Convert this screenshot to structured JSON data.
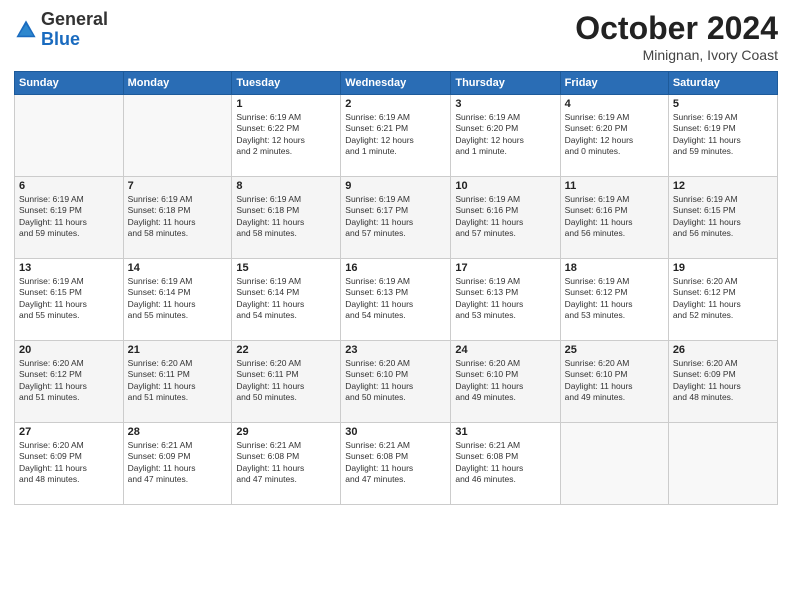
{
  "logo": {
    "general": "General",
    "blue": "Blue"
  },
  "header": {
    "month": "October 2024",
    "location": "Minignan, Ivory Coast"
  },
  "days_of_week": [
    "Sunday",
    "Monday",
    "Tuesday",
    "Wednesday",
    "Thursday",
    "Friday",
    "Saturday"
  ],
  "weeks": [
    [
      {
        "day": "",
        "info": ""
      },
      {
        "day": "",
        "info": ""
      },
      {
        "day": "1",
        "info": "Sunrise: 6:19 AM\nSunset: 6:22 PM\nDaylight: 12 hours\nand 2 minutes."
      },
      {
        "day": "2",
        "info": "Sunrise: 6:19 AM\nSunset: 6:21 PM\nDaylight: 12 hours\nand 1 minute."
      },
      {
        "day": "3",
        "info": "Sunrise: 6:19 AM\nSunset: 6:20 PM\nDaylight: 12 hours\nand 1 minute."
      },
      {
        "day": "4",
        "info": "Sunrise: 6:19 AM\nSunset: 6:20 PM\nDaylight: 12 hours\nand 0 minutes."
      },
      {
        "day": "5",
        "info": "Sunrise: 6:19 AM\nSunset: 6:19 PM\nDaylight: 11 hours\nand 59 minutes."
      }
    ],
    [
      {
        "day": "6",
        "info": "Sunrise: 6:19 AM\nSunset: 6:19 PM\nDaylight: 11 hours\nand 59 minutes."
      },
      {
        "day": "7",
        "info": "Sunrise: 6:19 AM\nSunset: 6:18 PM\nDaylight: 11 hours\nand 58 minutes."
      },
      {
        "day": "8",
        "info": "Sunrise: 6:19 AM\nSunset: 6:18 PM\nDaylight: 11 hours\nand 58 minutes."
      },
      {
        "day": "9",
        "info": "Sunrise: 6:19 AM\nSunset: 6:17 PM\nDaylight: 11 hours\nand 57 minutes."
      },
      {
        "day": "10",
        "info": "Sunrise: 6:19 AM\nSunset: 6:16 PM\nDaylight: 11 hours\nand 57 minutes."
      },
      {
        "day": "11",
        "info": "Sunrise: 6:19 AM\nSunset: 6:16 PM\nDaylight: 11 hours\nand 56 minutes."
      },
      {
        "day": "12",
        "info": "Sunrise: 6:19 AM\nSunset: 6:15 PM\nDaylight: 11 hours\nand 56 minutes."
      }
    ],
    [
      {
        "day": "13",
        "info": "Sunrise: 6:19 AM\nSunset: 6:15 PM\nDaylight: 11 hours\nand 55 minutes."
      },
      {
        "day": "14",
        "info": "Sunrise: 6:19 AM\nSunset: 6:14 PM\nDaylight: 11 hours\nand 55 minutes."
      },
      {
        "day": "15",
        "info": "Sunrise: 6:19 AM\nSunset: 6:14 PM\nDaylight: 11 hours\nand 54 minutes."
      },
      {
        "day": "16",
        "info": "Sunrise: 6:19 AM\nSunset: 6:13 PM\nDaylight: 11 hours\nand 54 minutes."
      },
      {
        "day": "17",
        "info": "Sunrise: 6:19 AM\nSunset: 6:13 PM\nDaylight: 11 hours\nand 53 minutes."
      },
      {
        "day": "18",
        "info": "Sunrise: 6:19 AM\nSunset: 6:12 PM\nDaylight: 11 hours\nand 53 minutes."
      },
      {
        "day": "19",
        "info": "Sunrise: 6:20 AM\nSunset: 6:12 PM\nDaylight: 11 hours\nand 52 minutes."
      }
    ],
    [
      {
        "day": "20",
        "info": "Sunrise: 6:20 AM\nSunset: 6:12 PM\nDaylight: 11 hours\nand 51 minutes."
      },
      {
        "day": "21",
        "info": "Sunrise: 6:20 AM\nSunset: 6:11 PM\nDaylight: 11 hours\nand 51 minutes."
      },
      {
        "day": "22",
        "info": "Sunrise: 6:20 AM\nSunset: 6:11 PM\nDaylight: 11 hours\nand 50 minutes."
      },
      {
        "day": "23",
        "info": "Sunrise: 6:20 AM\nSunset: 6:10 PM\nDaylight: 11 hours\nand 50 minutes."
      },
      {
        "day": "24",
        "info": "Sunrise: 6:20 AM\nSunset: 6:10 PM\nDaylight: 11 hours\nand 49 minutes."
      },
      {
        "day": "25",
        "info": "Sunrise: 6:20 AM\nSunset: 6:10 PM\nDaylight: 11 hours\nand 49 minutes."
      },
      {
        "day": "26",
        "info": "Sunrise: 6:20 AM\nSunset: 6:09 PM\nDaylight: 11 hours\nand 48 minutes."
      }
    ],
    [
      {
        "day": "27",
        "info": "Sunrise: 6:20 AM\nSunset: 6:09 PM\nDaylight: 11 hours\nand 48 minutes."
      },
      {
        "day": "28",
        "info": "Sunrise: 6:21 AM\nSunset: 6:09 PM\nDaylight: 11 hours\nand 47 minutes."
      },
      {
        "day": "29",
        "info": "Sunrise: 6:21 AM\nSunset: 6:08 PM\nDaylight: 11 hours\nand 47 minutes."
      },
      {
        "day": "30",
        "info": "Sunrise: 6:21 AM\nSunset: 6:08 PM\nDaylight: 11 hours\nand 47 minutes."
      },
      {
        "day": "31",
        "info": "Sunrise: 6:21 AM\nSunset: 6:08 PM\nDaylight: 11 hours\nand 46 minutes."
      },
      {
        "day": "",
        "info": ""
      },
      {
        "day": "",
        "info": ""
      }
    ]
  ]
}
